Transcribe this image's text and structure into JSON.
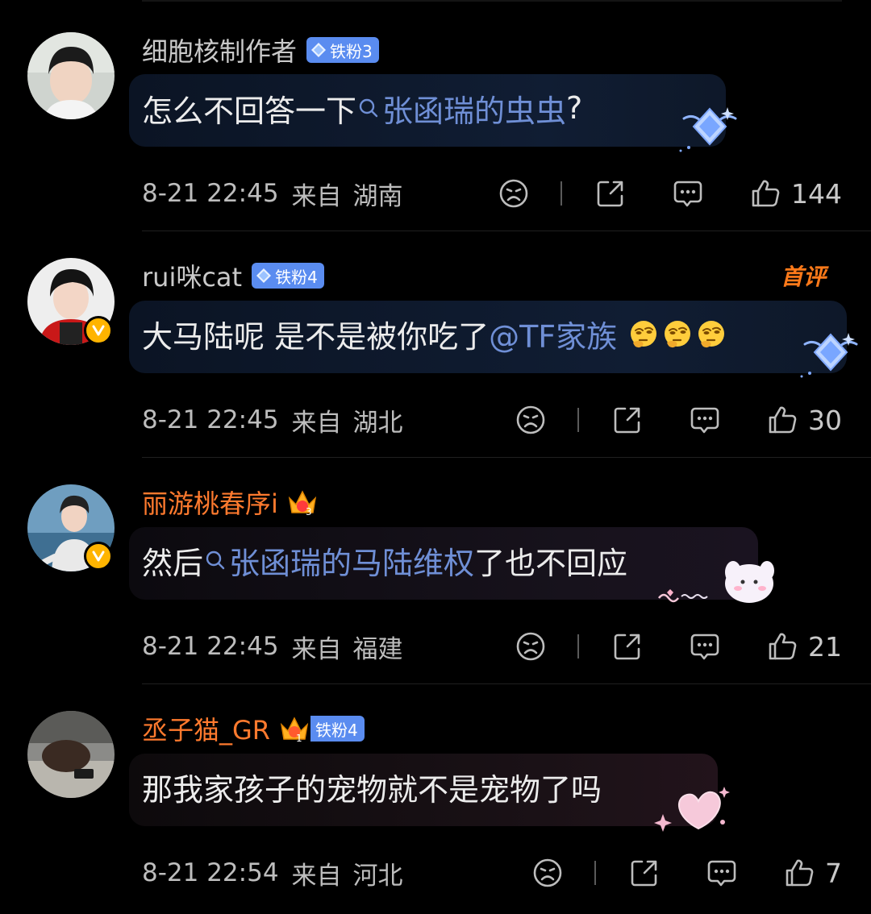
{
  "comments": [
    {
      "username": "细胞核制作者",
      "fan_badge": "铁粉3",
      "text_before": "怎么不回答一下",
      "topic": "张函瑞的虫虫",
      "text_after": " ?",
      "time": "8-21 22:45",
      "from_label": "来自",
      "location": "湖南",
      "likes": "144"
    },
    {
      "username": "rui咪cat",
      "fan_badge": "铁粉4",
      "first_label": "首评",
      "text_before": "大马陆呢 是不是被你吃了",
      "mention": "@TF家族",
      "time": "8-21 22:45",
      "from_label": "来自",
      "location": "湖北",
      "likes": "30"
    },
    {
      "username": "丽游桃春序i",
      "text_before": "然后",
      "topic": "张函瑞的马陆维权",
      "text_after": " 了也不回应",
      "time": "8-21 22:45",
      "from_label": "来自",
      "location": "福建",
      "likes": "21"
    },
    {
      "username": "丞子猫_GR",
      "fan_badge": "铁粉4",
      "text_before": "那我家孩子的宠物就不是宠物了吗",
      "time": "8-21 22:54",
      "from_label": "来自",
      "location": "河北",
      "likes": "7"
    }
  ],
  "colors": {
    "background": "#000000",
    "username_default": "#c9c9c9",
    "username_member": "#ff7a2e",
    "link_blue": "#6f8fd6",
    "fan_badge": "#5a8cf0",
    "verified": "#ffb400"
  }
}
